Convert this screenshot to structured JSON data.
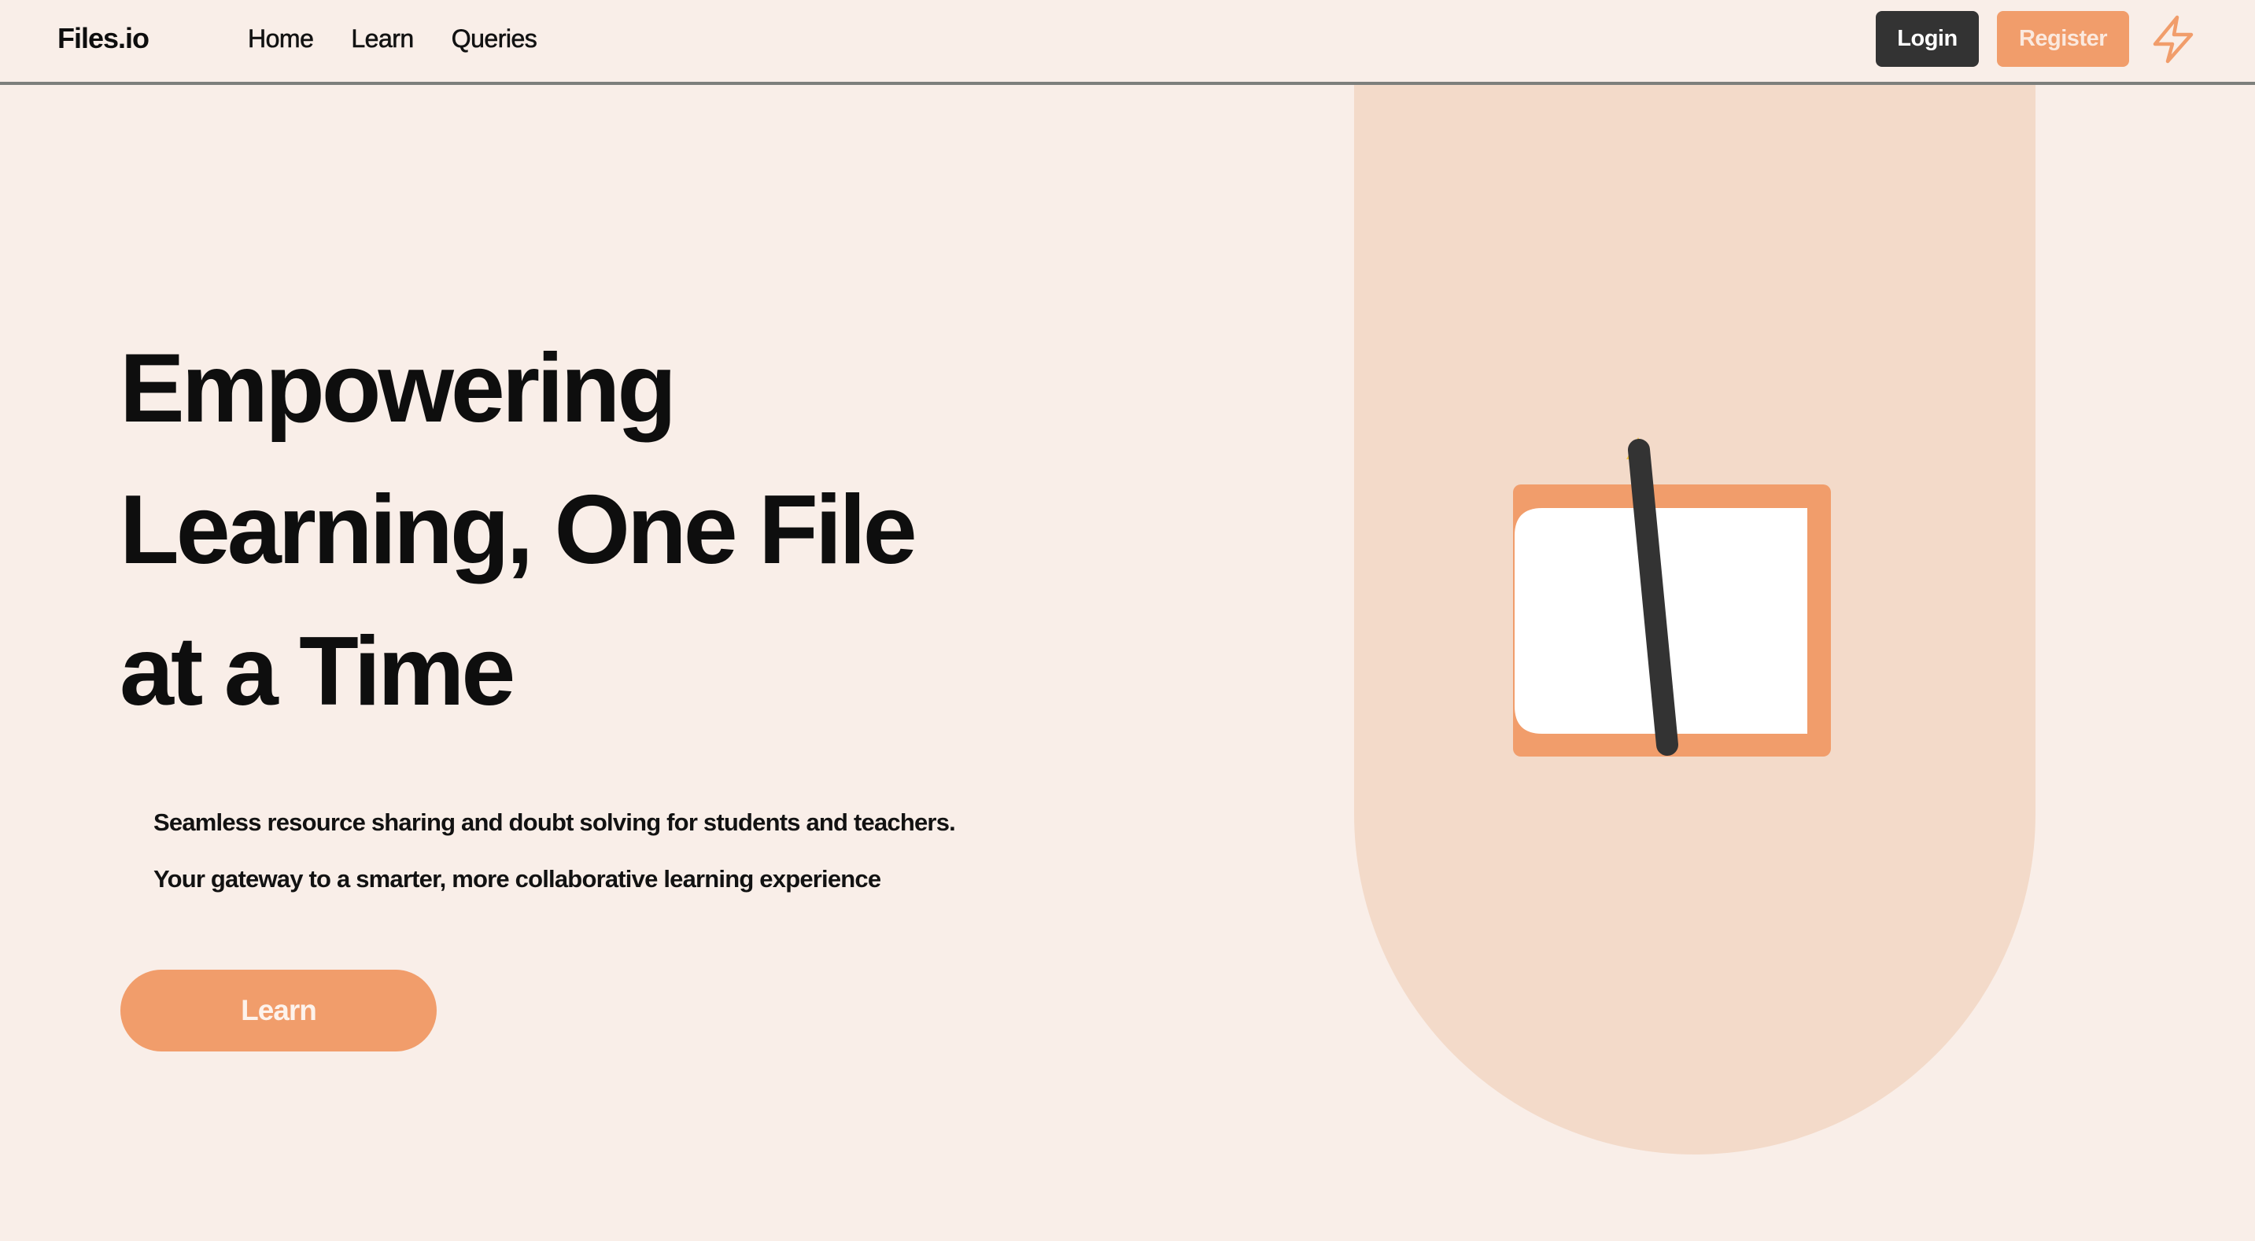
{
  "header": {
    "brand": "Files.io",
    "nav": [
      {
        "label": "Home"
      },
      {
        "label": "Learn"
      },
      {
        "label": "Queries"
      }
    ],
    "login_label": "Login",
    "register_label": "Register",
    "theme_icon": "lightning-bolt-icon"
  },
  "hero": {
    "title_lines": [
      "Empowering",
      "Learning, One File",
      "at a Time"
    ],
    "subtitle_lines": [
      "Seamless resource sharing and doubt solving for students and teachers.",
      "Your gateway to a smarter, more collaborative learning experience"
    ],
    "cta_label": "Learn",
    "illustration": "notepad-with-pencil-illustration"
  },
  "colors": {
    "background": "#f9eee8",
    "accent": "#f19d6b",
    "arch": "#f3dac9",
    "dark": "#333333",
    "pencil_tip": "#f2c445"
  }
}
